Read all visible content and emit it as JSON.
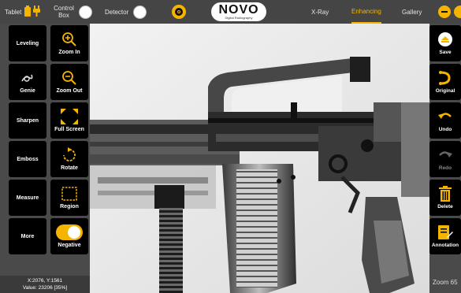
{
  "topbar": {
    "tablet_label": "Tablet",
    "control_box_label": "Control Box",
    "detector_label": "Detector",
    "logo_text": "NOVO",
    "logo_subtext": "Digital Radiography",
    "tabs": [
      {
        "label": "X-Ray",
        "active": false
      },
      {
        "label": "Enhancing",
        "active": true
      },
      {
        "label": "Gallery",
        "active": false
      }
    ]
  },
  "left_tools": {
    "leveling": "Leveling",
    "zoom_in": "Zoom In",
    "genie": "Genie",
    "zoom_out": "Zoom Out",
    "sharpen": "Sharpen",
    "full_screen": "Full Screen",
    "emboss": "Emboss",
    "rotate": "Rotate",
    "measure": "Measure",
    "region": "Region",
    "more": "More",
    "negative": "Negative"
  },
  "right_tools": {
    "save": "Save",
    "original": "Original",
    "undo": "Undo",
    "redo": "Redo",
    "delete": "Delete",
    "annotation": "Annotation"
  },
  "status": {
    "coords": "X:2076, Y:1561",
    "value": "Value: 23206 [35%]"
  },
  "zoom_text": "Zoom 65",
  "colors": {
    "accent": "#f4b400",
    "panel": "#4a4a4a",
    "button": "#000000"
  }
}
